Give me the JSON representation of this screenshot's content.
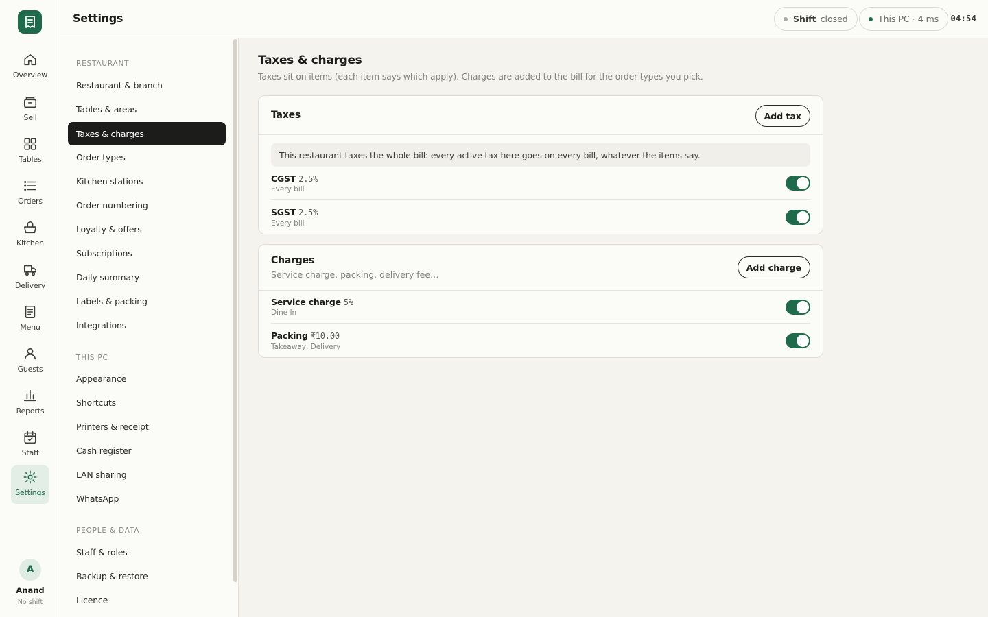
{
  "header": {
    "title": "Settings",
    "shift_label": "Shift",
    "shift_status": "closed",
    "connection": "This PC · 4 ms",
    "clock": "04:54",
    "colors": {
      "shift_dot": "#a8a7a0",
      "connection_dot": "#1f6a4a"
    }
  },
  "rail": {
    "items": [
      {
        "label": "Overview",
        "icon": "home-icon"
      },
      {
        "label": "Sell",
        "icon": "register-icon"
      },
      {
        "label": "Tables",
        "icon": "grid-icon"
      },
      {
        "label": "Orders",
        "icon": "list-icon"
      },
      {
        "label": "Kitchen",
        "icon": "basket-icon"
      },
      {
        "label": "Delivery",
        "icon": "delivery-icon"
      },
      {
        "label": "Menu",
        "icon": "menu-icon"
      },
      {
        "label": "Guests",
        "icon": "person-icon"
      },
      {
        "label": "Reports",
        "icon": "bar-chart-icon"
      },
      {
        "label": "Staff",
        "icon": "calendar-check-icon"
      },
      {
        "label": "Settings",
        "icon": "gear-icon"
      }
    ],
    "active": "Settings",
    "user": {
      "initial": "A",
      "name": "Anand",
      "shift": "No shift"
    }
  },
  "settings_nav": {
    "sections": [
      {
        "title": "Restaurant",
        "items": [
          "Restaurant & branch",
          "Tables & areas",
          "Taxes & charges",
          "Order types",
          "Kitchen stations",
          "Order numbering",
          "Loyalty & offers",
          "Subscriptions",
          "Daily summary",
          "Labels & packing",
          "Integrations"
        ]
      },
      {
        "title": "This PC",
        "items": [
          "Appearance",
          "Shortcuts",
          "Printers & receipt",
          "Cash register",
          "LAN sharing",
          "WhatsApp"
        ]
      },
      {
        "title": "People & data",
        "items": [
          "Staff & roles",
          "Backup & restore",
          "Licence"
        ]
      }
    ],
    "active": "Taxes & charges"
  },
  "main": {
    "title": "Taxes & charges",
    "subtitle": "Taxes sit on items (each item says which apply). Charges are added to the bill for the order types you pick.",
    "taxes": {
      "title": "Taxes",
      "add_label": "Add tax",
      "note": "This restaurant taxes the whole bill: every active tax here goes on every bill, whatever the items say.",
      "rows": [
        {
          "name": "CGST",
          "value": "2.5%",
          "meta": "Every bill",
          "enabled": true
        },
        {
          "name": "SGST",
          "value": "2.5%",
          "meta": "Every bill",
          "enabled": true
        }
      ]
    },
    "charges": {
      "title": "Charges",
      "subtitle": "Service charge, packing, delivery fee…",
      "add_label": "Add charge",
      "rows": [
        {
          "name": "Service charge",
          "value": "5%",
          "meta": "Dine In",
          "enabled": true
        },
        {
          "name": "Packing",
          "value": "₹10.00",
          "meta": "Takeaway, Delivery",
          "enabled": true
        }
      ]
    }
  },
  "colors": {
    "accent": "#1f6a4a",
    "active_nav": "#1c1c1a",
    "background": "#f4f3ee"
  }
}
